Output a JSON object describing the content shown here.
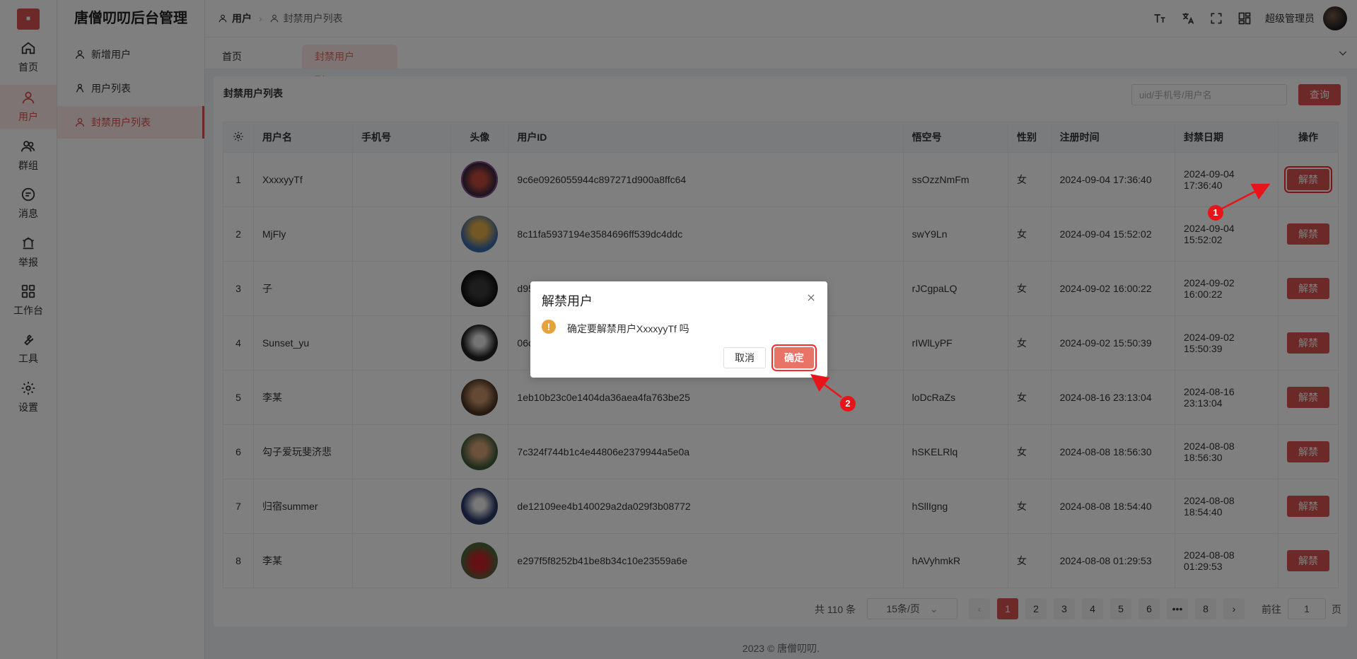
{
  "brand": "唐僧叨叨后台管理",
  "rail": [
    {
      "label": "首页",
      "icon": "home-icon"
    },
    {
      "label": "用户",
      "icon": "user-icon"
    },
    {
      "label": "群组",
      "icon": "group-icon"
    },
    {
      "label": "消息",
      "icon": "message-icon"
    },
    {
      "label": "举报",
      "icon": "report-icon"
    },
    {
      "label": "工作台",
      "icon": "grid-icon"
    },
    {
      "label": "工具",
      "icon": "wrench-icon"
    },
    {
      "label": "设置",
      "icon": "gear-icon"
    }
  ],
  "submenu": [
    {
      "label": "新增用户"
    },
    {
      "label": "用户列表"
    },
    {
      "label": "封禁用户列表"
    }
  ],
  "breadcrumb": {
    "first": "用户",
    "second": "封禁用户列表"
  },
  "header": {
    "user_name": "超级管理员"
  },
  "tabs": {
    "home": "首页",
    "active": "封禁用户列..."
  },
  "card": {
    "title": "封禁用户列表",
    "search_placeholder": "uid/手机号/用户名",
    "query_label": "查询"
  },
  "table": {
    "columns": [
      "用户名",
      "手机号",
      "头像",
      "用户ID",
      "悟空号",
      "性别",
      "注册时间",
      "封禁日期",
      "操作"
    ],
    "action_label": "解禁",
    "rows": [
      {
        "no": "1",
        "name": "XxxxyyTf",
        "phone": "",
        "uid": "9c6e0926055944c897271d900a8ffc64",
        "wk": "ssOzzNmFm",
        "sex": "女",
        "reg": "2024-09-04 17:36:40",
        "ban": "2024-09-04 17:36:40"
      },
      {
        "no": "2",
        "name": "MjFly",
        "phone": "",
        "uid": "8c11fa5937194e3584696ff539dc4ddc",
        "wk": "swY9Ln",
        "sex": "女",
        "reg": "2024-09-04 15:52:02",
        "ban": "2024-09-04 15:52:02"
      },
      {
        "no": "3",
        "name": "子",
        "phone": "",
        "uid": "d95de",
        "wk": "rJCgpaLQ",
        "sex": "女",
        "reg": "2024-09-02 16:00:22",
        "ban": "2024-09-02 16:00:22"
      },
      {
        "no": "4",
        "name": "Sunset_yu",
        "phone": "",
        "uid": "06c62",
        "wk": "rIWlLyPF",
        "sex": "女",
        "reg": "2024-09-02 15:50:39",
        "ban": "2024-09-02 15:50:39"
      },
      {
        "no": "5",
        "name": "李某",
        "phone": "",
        "uid": "1eb10b23c0e1404da36aea4fa763be25",
        "wk": "loDcRaZs",
        "sex": "女",
        "reg": "2024-08-16 23:13:04",
        "ban": "2024-08-16 23:13:04"
      },
      {
        "no": "6",
        "name": "勾子爱玩斐济悲",
        "phone": "",
        "uid": "7c324f744b1c4e44806e2379944a5e0a",
        "wk": "hSKELRlq",
        "sex": "女",
        "reg": "2024-08-08 18:56:30",
        "ban": "2024-08-08 18:56:30"
      },
      {
        "no": "7",
        "name": "归宿summer",
        "phone": "",
        "uid": "de12109ee4b140029a2da029f3b08772",
        "wk": "hSllIgng",
        "sex": "女",
        "reg": "2024-08-08 18:54:40",
        "ban": "2024-08-08 18:54:40"
      },
      {
        "no": "8",
        "name": "李某",
        "phone": "",
        "uid": "e297f5f8252b41be8b34c10e23559a6e",
        "wk": "hAVyhmkR",
        "sex": "女",
        "reg": "2024-08-08 01:29:53",
        "ban": "2024-08-08 01:29:53"
      }
    ]
  },
  "pager": {
    "total": "共 110 条",
    "page_size": "15条/页",
    "pages": [
      "1",
      "2",
      "3",
      "4",
      "5",
      "6",
      "•••",
      "8"
    ],
    "current": "1",
    "goto_label": "前往",
    "goto_value": "1",
    "page_suffix": "页"
  },
  "footer": "2023 © 唐僧叨叨.",
  "dialog": {
    "title": "解禁用户",
    "message": "确定要解禁用户XxxxyyTf 吗",
    "cancel": "取消",
    "confirm": "确定"
  },
  "annotations": [
    "1",
    "2"
  ],
  "colors": {
    "primary": "#d9534f",
    "active_bg": "#fce9e7",
    "warning": "#e6a23c",
    "annotation": "#e8141a"
  }
}
